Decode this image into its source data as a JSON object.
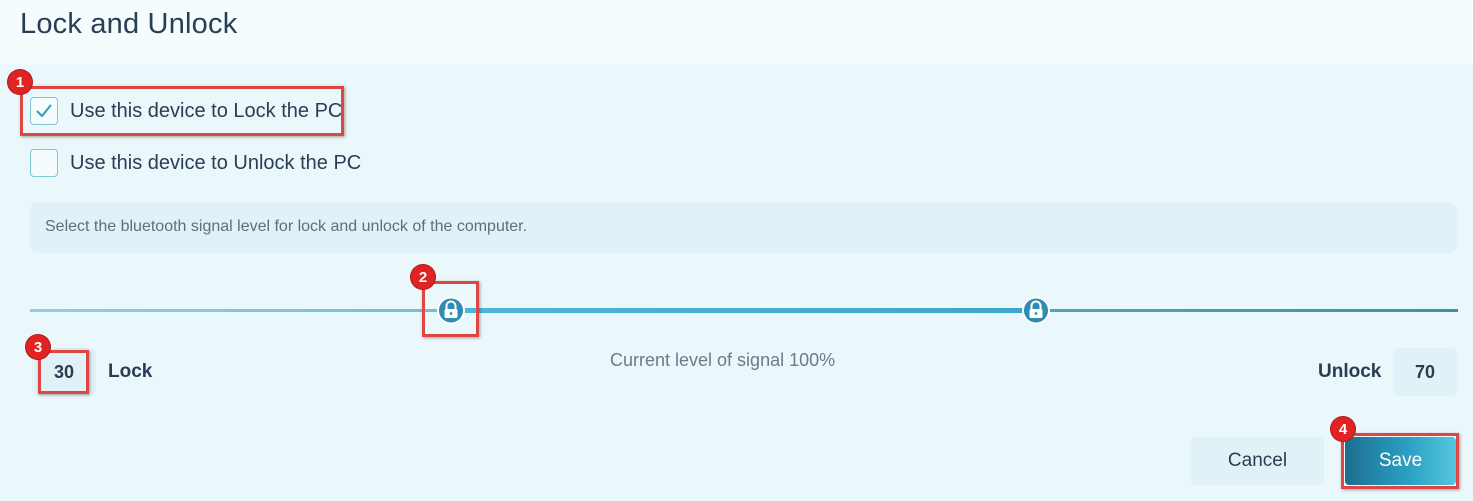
{
  "title": "Lock and Unlock",
  "options": {
    "lock_label": "Use this device to Lock the PC",
    "lock_checked": true,
    "unlock_label": "Use this device to Unlock the PC",
    "unlock_checked": false
  },
  "info_text": "Select the bluetooth signal level for lock and unlock of the computer.",
  "slider": {
    "min": 0,
    "max": 100,
    "lock_value": 30,
    "unlock_value": 70
  },
  "lock": {
    "value": "30",
    "label": "Lock"
  },
  "unlock": {
    "label": "Unlock",
    "value": "70"
  },
  "current_signal": "Current level of signal 100%",
  "buttons": {
    "cancel": "Cancel",
    "save": "Save"
  },
  "annotations": [
    "1",
    "2",
    "3",
    "4"
  ],
  "colors": {
    "accent": "#2a9ec2",
    "annotation": "#e02424",
    "track_light": "#8fd0e0",
    "track_dark": "#3f8fad"
  },
  "icons": {
    "checkmark": "checkmark-icon",
    "lock_handle": "padlock-icon",
    "unlock_handle": "padlock-icon"
  }
}
